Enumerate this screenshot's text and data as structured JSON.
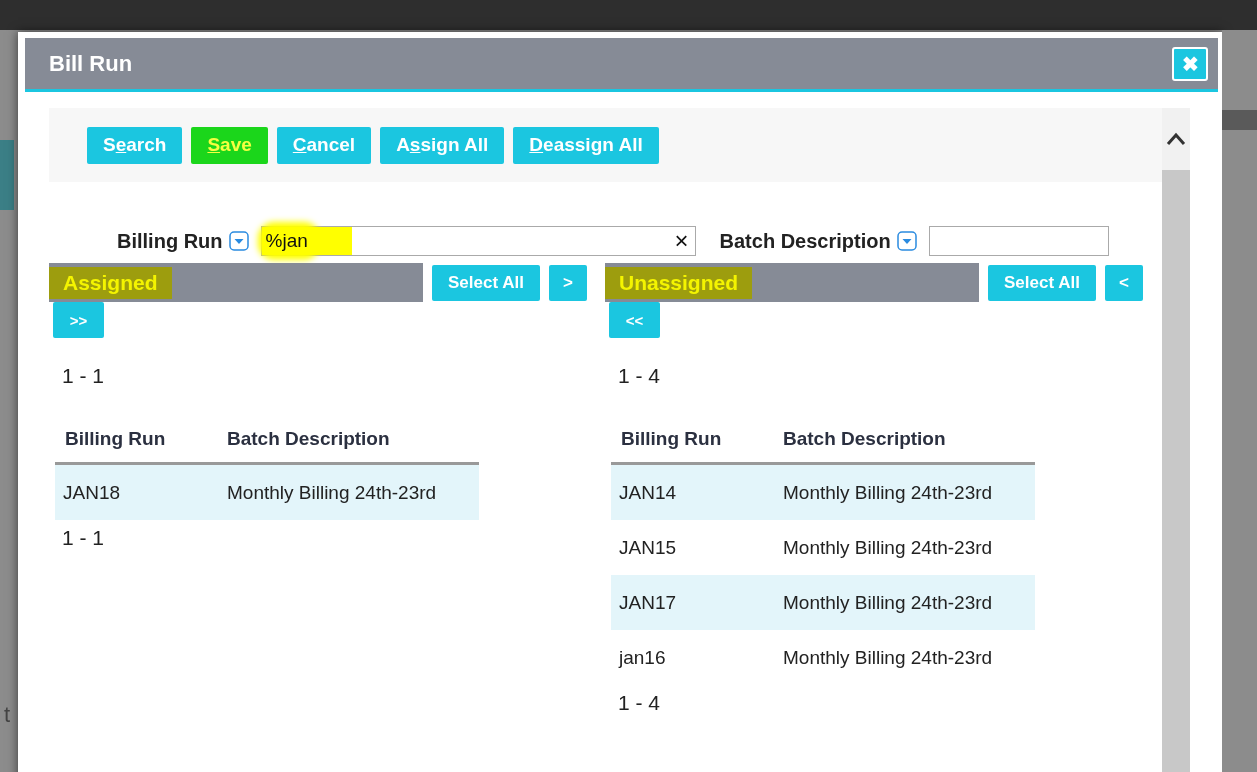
{
  "backdrop_text": "t",
  "dialog": {
    "title": "Bill Run",
    "close": "✖"
  },
  "toolbar": [
    {
      "pre": "S",
      "key": "e",
      "post": "arch",
      "highlighted": false
    },
    {
      "key": "S",
      "post": "ave",
      "highlighted": true
    },
    {
      "key": "C",
      "post": "ancel",
      "highlighted": false
    },
    {
      "pre": "A",
      "key": "s",
      "post": "sign All",
      "highlighted": false
    },
    {
      "key": "D",
      "post": "eassign All",
      "highlighted": false
    }
  ],
  "filters": [
    {
      "label": "Billing Run",
      "value": "%jan",
      "clear": "×",
      "highlighted": true
    },
    {
      "label": "Batch Description"
    }
  ],
  "lists": [
    {
      "heading": "Assigned",
      "highlighted": true,
      "select_all": "Select All",
      "move_one": ">",
      "move_all": ">>",
      "count_top": "1 - 1",
      "columns": [
        "Billing Run",
        "Batch Description"
      ],
      "rows": [
        {
          "billing_run": "JAN18",
          "batch_description": "Monthly Billing 24th-23rd"
        }
      ],
      "count_bottom": "1 - 1"
    },
    {
      "heading": "Unassigned",
      "highlighted": true,
      "select_all": "Select All",
      "move_one": "<",
      "move_all": "<<",
      "count_top": "1 - 4",
      "columns": [
        "Billing Run",
        "Batch Description"
      ],
      "rows": [
        {
          "billing_run": "JAN14",
          "batch_description": "Monthly Billing 24th-23rd"
        },
        {
          "billing_run": "JAN15",
          "batch_description": "Monthly Billing 24th-23rd"
        },
        {
          "billing_run": "JAN17",
          "batch_description": "Monthly Billing 24th-23rd"
        },
        {
          "billing_run": "jan16",
          "batch_description": "Monthly Billing 24th-23rd"
        }
      ],
      "count_bottom": "1 - 4"
    }
  ]
}
